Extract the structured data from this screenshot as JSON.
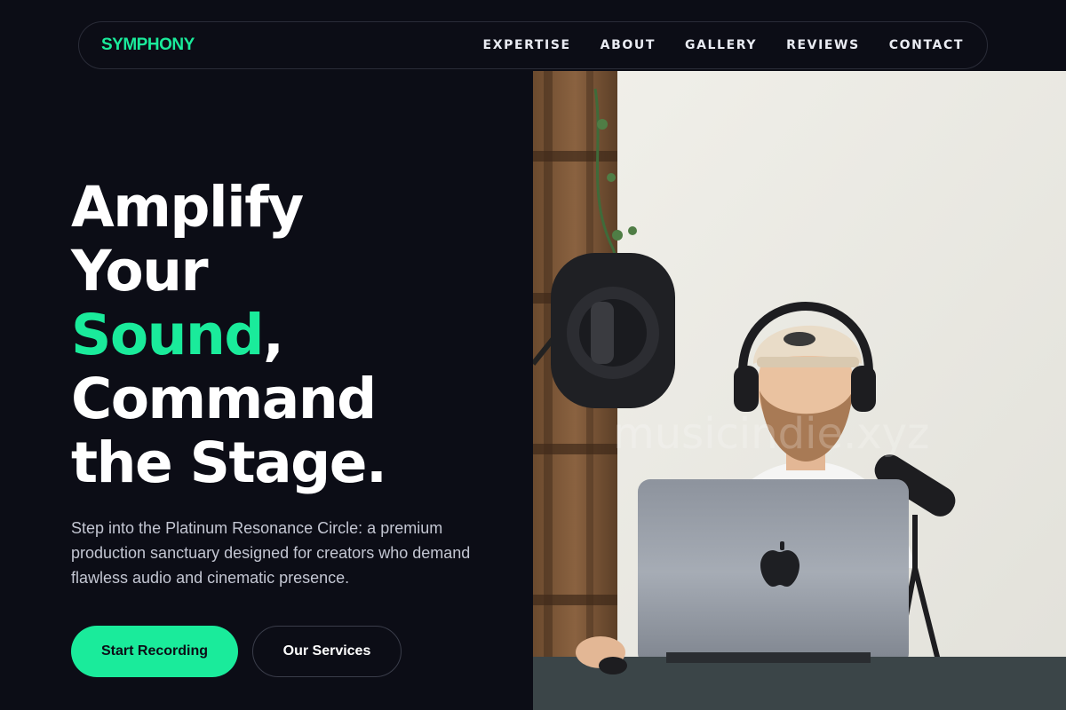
{
  "brand": {
    "name": "SYMPHONY",
    "accent_color": "#1aeb9b"
  },
  "nav": {
    "links": [
      "EXPERTISE",
      "ABOUT",
      "GALLERY",
      "REVIEWS",
      "CONTACT"
    ]
  },
  "hero": {
    "title": {
      "line1": "Amplify",
      "line2": "Your",
      "line3_accent": "Sound",
      "line3_rest": ",",
      "line4": "Command",
      "line5": "the Stage."
    },
    "subtitle": "Step into the Platinum Resonance Circle: a premium production sanctuary designed for creators who demand flawless audio and cinematic presence.",
    "buttons": {
      "primary": "Start Recording",
      "secondary": "Our Services"
    },
    "image": {
      "description_icon": "music-producer-photo",
      "watermark": "musicindie.xyz"
    }
  },
  "colors": {
    "background": "#0c0d16",
    "accent": "#1aeb9b",
    "text": "#ffffff",
    "muted": "#c3c6d2"
  }
}
